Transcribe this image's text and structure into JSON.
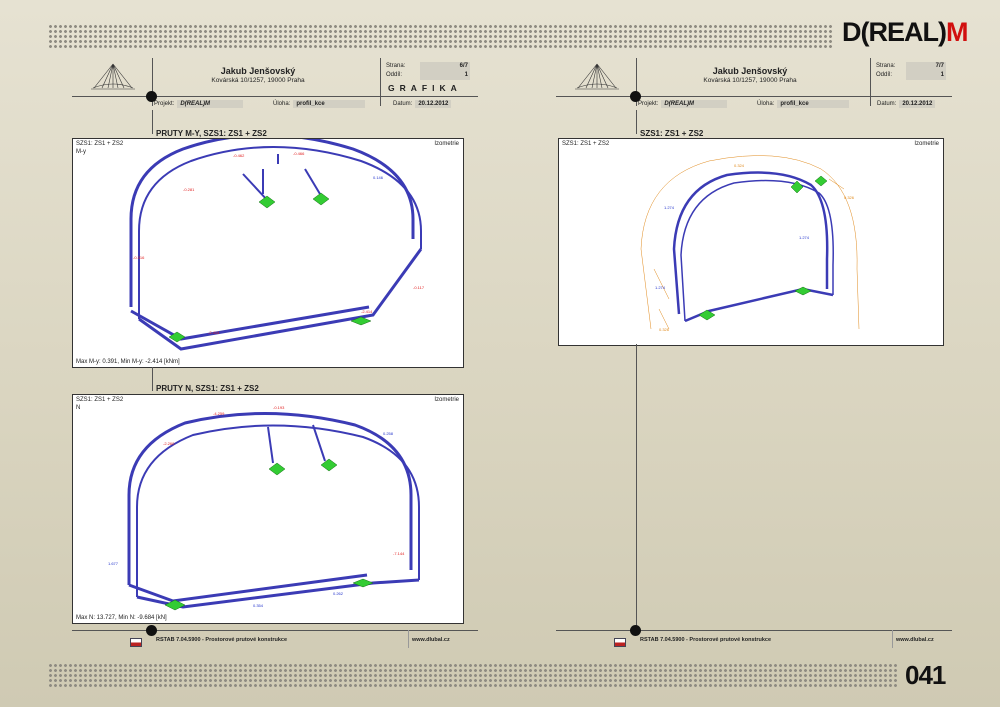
{
  "brand": {
    "prefix": "D(REAL)",
    "accent": "M"
  },
  "page_number": "041",
  "sheets": [
    {
      "author": "Jakub Jenšovský",
      "address": "Kovárská 10/1257, 19000 Praha",
      "strana_label": "Strana:",
      "strana_value": "6/7",
      "oddil_label": "Oddíl:",
      "oddil_value": "1",
      "grafika": "GRAFIKA",
      "projekt_label": "Projekt:",
      "projekt_value": "D(REAL)M",
      "uloha_label": "Úloha:",
      "uloha_value": "profil_kce",
      "datum_label": "Datum:",
      "datum_value": "20.12.2012",
      "sections": [
        {
          "title": "PRUTY M-Y, SZS1: ZS1 + ZS2",
          "corner": "SZS1: ZS1 + ZS2",
          "quantity": "M-y",
          "view": "Izometrie",
          "footer": "Max M-y: 0.391, Min M-y: -2.414 [kNm]"
        },
        {
          "title": "PRUTY N, SZS1: ZS1 + ZS2",
          "corner": "SZS1: ZS1 + ZS2",
          "quantity": "N",
          "view": "Izometrie",
          "footer": "Max N: 13.727, Min N: -9.684 [kN]"
        }
      ],
      "footer_left": "RSTAB 7.04.5900 - Prostorové prutové konstrukce",
      "footer_right": "www.dlubal.cz"
    },
    {
      "author": "Jakub Jenšovský",
      "address": "Kovárská 10/1257, 19000 Praha",
      "strana_label": "Strana:",
      "strana_value": "7/7",
      "oddil_label": "Oddíl:",
      "oddil_value": "1",
      "projekt_label": "Projekt:",
      "projekt_value": "D(REAL)M",
      "uloha_label": "Úloha:",
      "uloha_value": "profil_kce",
      "datum_label": "Datum:",
      "datum_value": "20.12.2012",
      "sections": [
        {
          "title": "SZS1: ZS1 + ZS2",
          "corner": "SZS1: ZS1 + ZS2",
          "view": "Izometrie"
        }
      ],
      "footer_left": "RSTAB 7.04.5900 - Prostorové prutové konstrukce",
      "footer_right": "www.dlubal.cz"
    }
  ],
  "colors": {
    "frame": "#3b3bb5",
    "support": "#33cc33",
    "negative": "#e01b1b",
    "positive": "#2233cc",
    "displacement": "#e08a1c"
  }
}
